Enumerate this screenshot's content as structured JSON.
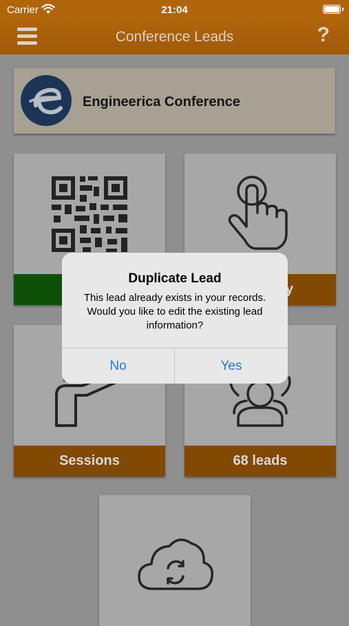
{
  "status_bar": {
    "carrier": "Carrier",
    "time": "21:04"
  },
  "nav": {
    "title": "Conference Leads",
    "help": "?"
  },
  "event": {
    "name": "Engineerica Conference",
    "logo_letter": "e"
  },
  "tiles": {
    "scan": {
      "label": ""
    },
    "manual": {
      "label": "y"
    },
    "sessions": {
      "label": "Sessions"
    },
    "leads": {
      "label": "68 leads"
    }
  },
  "dialog": {
    "title": "Duplicate Lead",
    "message": "This lead already exists in your records. Would you like to edit the existing lead information?",
    "no_label": "No",
    "yes_label": "Yes"
  },
  "colors": {
    "brand_orange": "#b1650b",
    "scan_green": "#0e4f08",
    "tile_label": "#824902",
    "dialog_button": "#1e78e6"
  }
}
